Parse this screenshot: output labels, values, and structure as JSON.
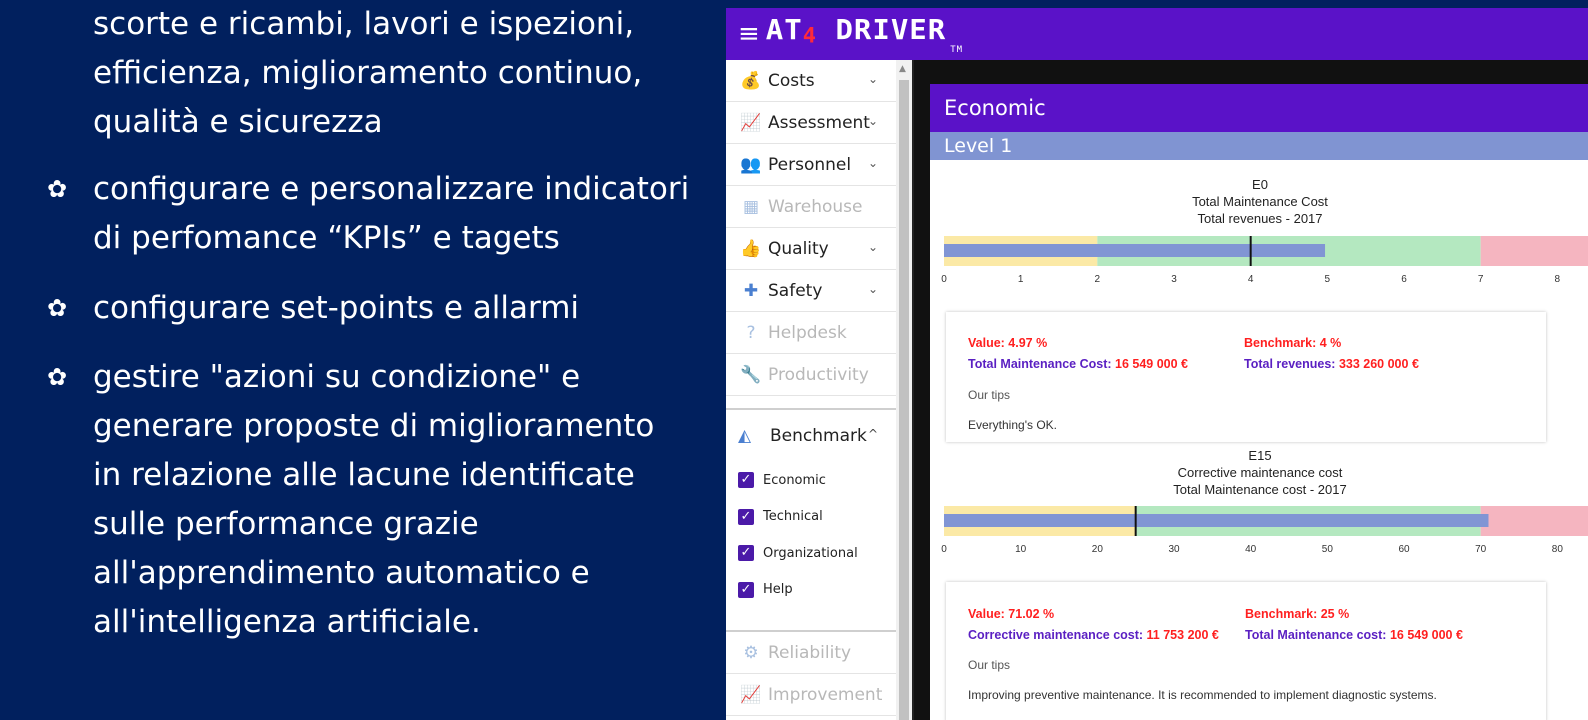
{
  "slide": {
    "continuation": "scorte e ricambi, lavori e ispezioni,\nefficienza, miglioramento continuo,\nqualità e sicurezza",
    "bullets": [
      "configurare e personalizzare indicatori\ndi perfomance “KPIs” e tagets",
      "configurare set-points e allarmi",
      "gestire \"azioni su condizione\" e\ngenerare proposte di miglioramento\nin relazione alle lacune identificate\nsulle performance grazie\nall'apprendimento automatico e\nall'intelligenza artificiale."
    ],
    "bullet_icon": "gear-icon"
  },
  "app": {
    "logo_main": "AT",
    "logo_four": "4",
    "logo_rest": "DRIVER",
    "logo_tm": "TM",
    "header_color": "#5a12c8"
  },
  "sidebar": {
    "items": [
      {
        "label": "Costs",
        "icon": "money-icon",
        "enabled": true,
        "chevron": true
      },
      {
        "label": "Assessment",
        "icon": "trend-chart-icon",
        "enabled": true,
        "chevron": true
      },
      {
        "label": "Personnel",
        "icon": "people-icon",
        "enabled": true,
        "chevron": true
      },
      {
        "label": "Warehouse",
        "icon": "building-icon",
        "enabled": false,
        "chevron": false
      },
      {
        "label": "Quality",
        "icon": "thumbs-up-icon",
        "enabled": true,
        "chevron": true
      },
      {
        "label": "Safety",
        "icon": "first-aid-icon",
        "enabled": true,
        "chevron": true
      },
      {
        "label": "Helpdesk",
        "icon": "help-icon",
        "enabled": false,
        "chevron": false
      },
      {
        "label": "Productivity",
        "icon": "wrench-icon",
        "enabled": false,
        "chevron": false
      }
    ],
    "benchmark_label": "Benchmark",
    "checks": [
      "Economic",
      "Technical",
      "Organizational",
      "Help"
    ],
    "bottom_items": [
      {
        "label": "Reliability",
        "icon": "gears-icon",
        "enabled": false
      },
      {
        "label": "Improvement",
        "icon": "trend-chart-icon",
        "enabled": false
      }
    ]
  },
  "main": {
    "title": "Economic",
    "level": "Level 1",
    "kpis": [
      {
        "code": "E0",
        "line1": "Total Maintenance Cost",
        "line2": "Total revenues - 2017",
        "value_text": "Value: 4.97 %",
        "benchmark_text": "Benchmark: 4 %",
        "num_label": "Total Maintenance Cost:",
        "num_value": "16 549 000 €",
        "den_label": "Total revenues:",
        "den_value": "333 260 000 €",
        "tips_heading": "Our tips",
        "tips_text": "Everything's OK."
      },
      {
        "code": "E15",
        "line1": "Corrective maintenance cost",
        "line2": "Total Maintenance cost - 2017",
        "value_text": "Value: 71.02 %",
        "benchmark_text": "Benchmark: 25 %",
        "num_label": "Corrective maintenance cost:",
        "num_value": "11 753 200 €",
        "den_label": "Total Maintenance cost:",
        "den_value": "16 549 000 €",
        "tips_heading": "Our tips",
        "tips_text": "Improving preventive maintenance. It is recommended to implement diagnostic systems."
      }
    ]
  },
  "chart_data": [
    {
      "type": "bar",
      "orientation": "horizontal-bullet",
      "value": 4.97,
      "benchmark": 4,
      "ranges": [
        {
          "to": 2,
          "color": "#fbe9a6"
        },
        {
          "to": 7,
          "color": "#b4e8c0"
        },
        {
          "to": 9,
          "color": "#f5b5c0"
        }
      ],
      "ticks": [
        0,
        1,
        2,
        3,
        4,
        5,
        6,
        7,
        8
      ],
      "xlim": [
        0,
        8.4
      ],
      "bar_color": "#8195d4"
    },
    {
      "type": "bar",
      "orientation": "horizontal-bullet",
      "value": 71.02,
      "benchmark": 25,
      "ranges": [
        {
          "to": 25,
          "color": "#fbe9a6"
        },
        {
          "to": 70,
          "color": "#b4e8c0"
        },
        {
          "to": 90,
          "color": "#f5b5c0"
        }
      ],
      "ticks": [
        0,
        10,
        20,
        30,
        40,
        50,
        60,
        70,
        80
      ],
      "xlim": [
        0,
        84
      ],
      "bar_color": "#8195d4"
    }
  ]
}
